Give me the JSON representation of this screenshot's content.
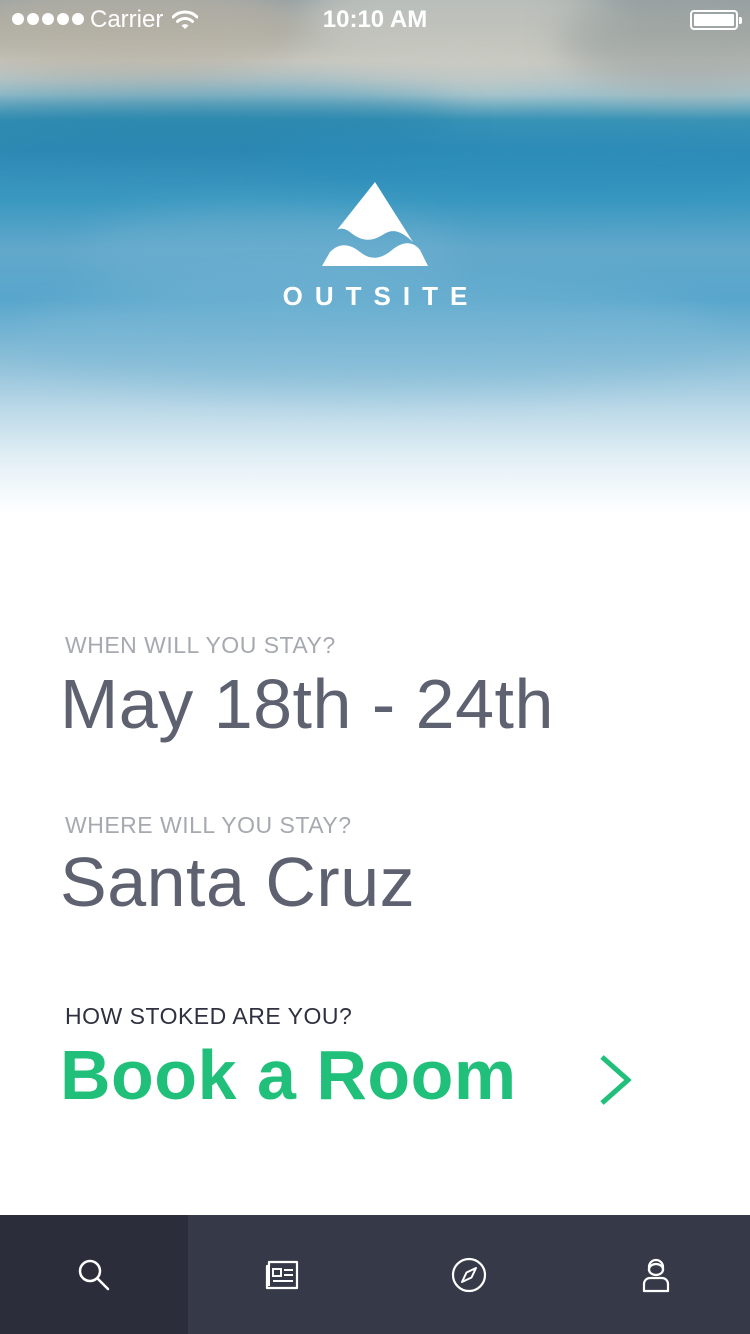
{
  "status_bar": {
    "carrier": "Carrier",
    "time": "10:10 AM"
  },
  "brand": {
    "name": "OUTSITE",
    "logo_icon": "mountain-wave-logo"
  },
  "booking": {
    "when_label": "WHEN WILL YOU STAY?",
    "dates": "May 18th - 24th",
    "where_label": "WHERE WILL YOU STAY?",
    "location": "Santa Cruz",
    "stoked_label": "HOW STOKED ARE YOU?",
    "cta_label": "Book a Room",
    "cta_icon": "chevron-right-icon"
  },
  "tab_bar": {
    "active_index": 0,
    "tabs": [
      {
        "icon": "search-icon"
      },
      {
        "icon": "news-icon"
      },
      {
        "icon": "compass-icon"
      },
      {
        "icon": "profile-icon"
      }
    ]
  },
  "colors": {
    "accent": "#20c07a",
    "value_text": "#5d6170",
    "muted_label": "#a6a9b0",
    "tab_bar_bg": "#363948",
    "tab_active_bg": "#2b2e3a"
  }
}
